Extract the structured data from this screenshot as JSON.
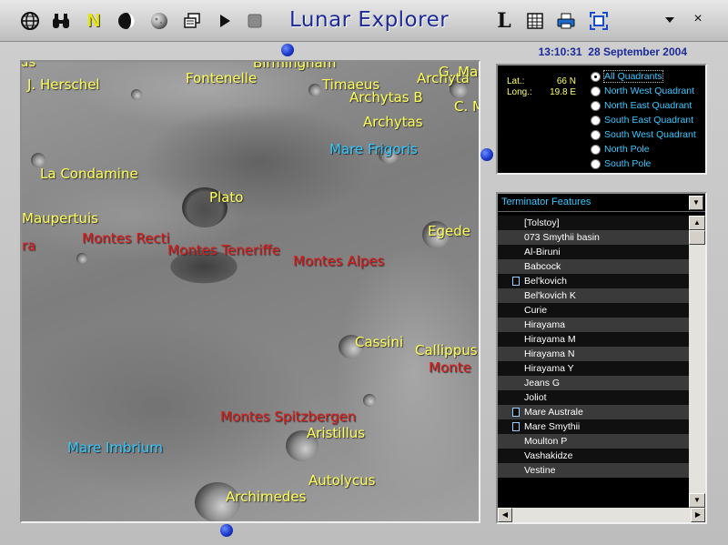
{
  "app": {
    "title": "Lunar Explorer"
  },
  "toolbar": {
    "left_icons": [
      "globe-icon",
      "binoculars-icon",
      "north-icon",
      "moon-phase-icon",
      "moon-sphere-icon",
      "windows-icon",
      "play-icon",
      "stop-icon"
    ],
    "north_label": "N",
    "labels_button": "L",
    "right_icons": [
      "labels-icon",
      "grid-icon",
      "print-icon",
      "fullscreen-icon"
    ],
    "close_label": "×"
  },
  "clock": {
    "time": "13:10:31",
    "date": "28 September 2004",
    "display": "13:10:31  28 September 2004"
  },
  "coords": {
    "lat_label": "Lat.:",
    "lat_value": "66 N",
    "long_label": "Long.:",
    "long_value": "19.8 E"
  },
  "quadrants": {
    "selected": "All Quadrants",
    "options": [
      "All Quadrants",
      "North West Quadrant",
      "North East Quadrant",
      "South East Quadrant",
      "South West Quadrant",
      "North Pole",
      "South Pole"
    ]
  },
  "features": {
    "filter": "Terminator Features",
    "items": [
      {
        "name": "[Tolstoy]",
        "icon": false
      },
      {
        "name": "073 Smythii basin",
        "icon": false
      },
      {
        "name": "Al-Biruni",
        "icon": false
      },
      {
        "name": "Babcock",
        "icon": false
      },
      {
        "name": "Bel'kovich",
        "icon": true
      },
      {
        "name": "Bel'kovich K",
        "icon": false
      },
      {
        "name": "Curie",
        "icon": false
      },
      {
        "name": "Hirayama",
        "icon": false
      },
      {
        "name": "Hirayama M",
        "icon": false
      },
      {
        "name": "Hirayama N",
        "icon": false
      },
      {
        "name": "Hirayama Y",
        "icon": false
      },
      {
        "name": "Jeans G",
        "icon": false
      },
      {
        "name": "Joliot",
        "icon": false
      },
      {
        "name": "Mare Australe",
        "icon": true
      },
      {
        "name": "Mare Smythii",
        "icon": true
      },
      {
        "name": "Moulton P",
        "icon": false
      },
      {
        "name": "Vashakidze",
        "icon": false
      },
      {
        "name": "Vestine",
        "icon": false
      }
    ]
  },
  "map_labels": [
    {
      "text": "J. Herschel",
      "color": "y"
    },
    {
      "text": "Fontenelle",
      "color": "y"
    },
    {
      "text": "Timaeus",
      "color": "y"
    },
    {
      "text": "Archytas B",
      "color": "y"
    },
    {
      "text": "Archytas",
      "color": "y"
    },
    {
      "text": "Archyta",
      "color": "y"
    },
    {
      "text": "G. Ma",
      "color": "y"
    },
    {
      "text": "C. M",
      "color": "y"
    },
    {
      "text": "Mare Frigoris",
      "color": "c"
    },
    {
      "text": "La Condamine",
      "color": "y"
    },
    {
      "text": "Plato",
      "color": "y"
    },
    {
      "text": "Maupertuis",
      "color": "y"
    },
    {
      "text": "Egede",
      "color": "y"
    },
    {
      "text": "ra",
      "color": "r"
    },
    {
      "text": "Montes Recti",
      "color": "r"
    },
    {
      "text": "Montes Teneriffe",
      "color": "r"
    },
    {
      "text": "Montes Alpes",
      "color": "r"
    },
    {
      "text": "Cassini",
      "color": "y"
    },
    {
      "text": "Callippus",
      "color": "y"
    },
    {
      "text": "Monte",
      "color": "r"
    },
    {
      "text": "Montes Spitzbergen",
      "color": "r"
    },
    {
      "text": "Aristillus",
      "color": "y"
    },
    {
      "text": "Mare Imbrium",
      "color": "c"
    },
    {
      "text": "Autolycus",
      "color": "y"
    },
    {
      "text": "Archimedes",
      "color": "y"
    }
  ]
}
